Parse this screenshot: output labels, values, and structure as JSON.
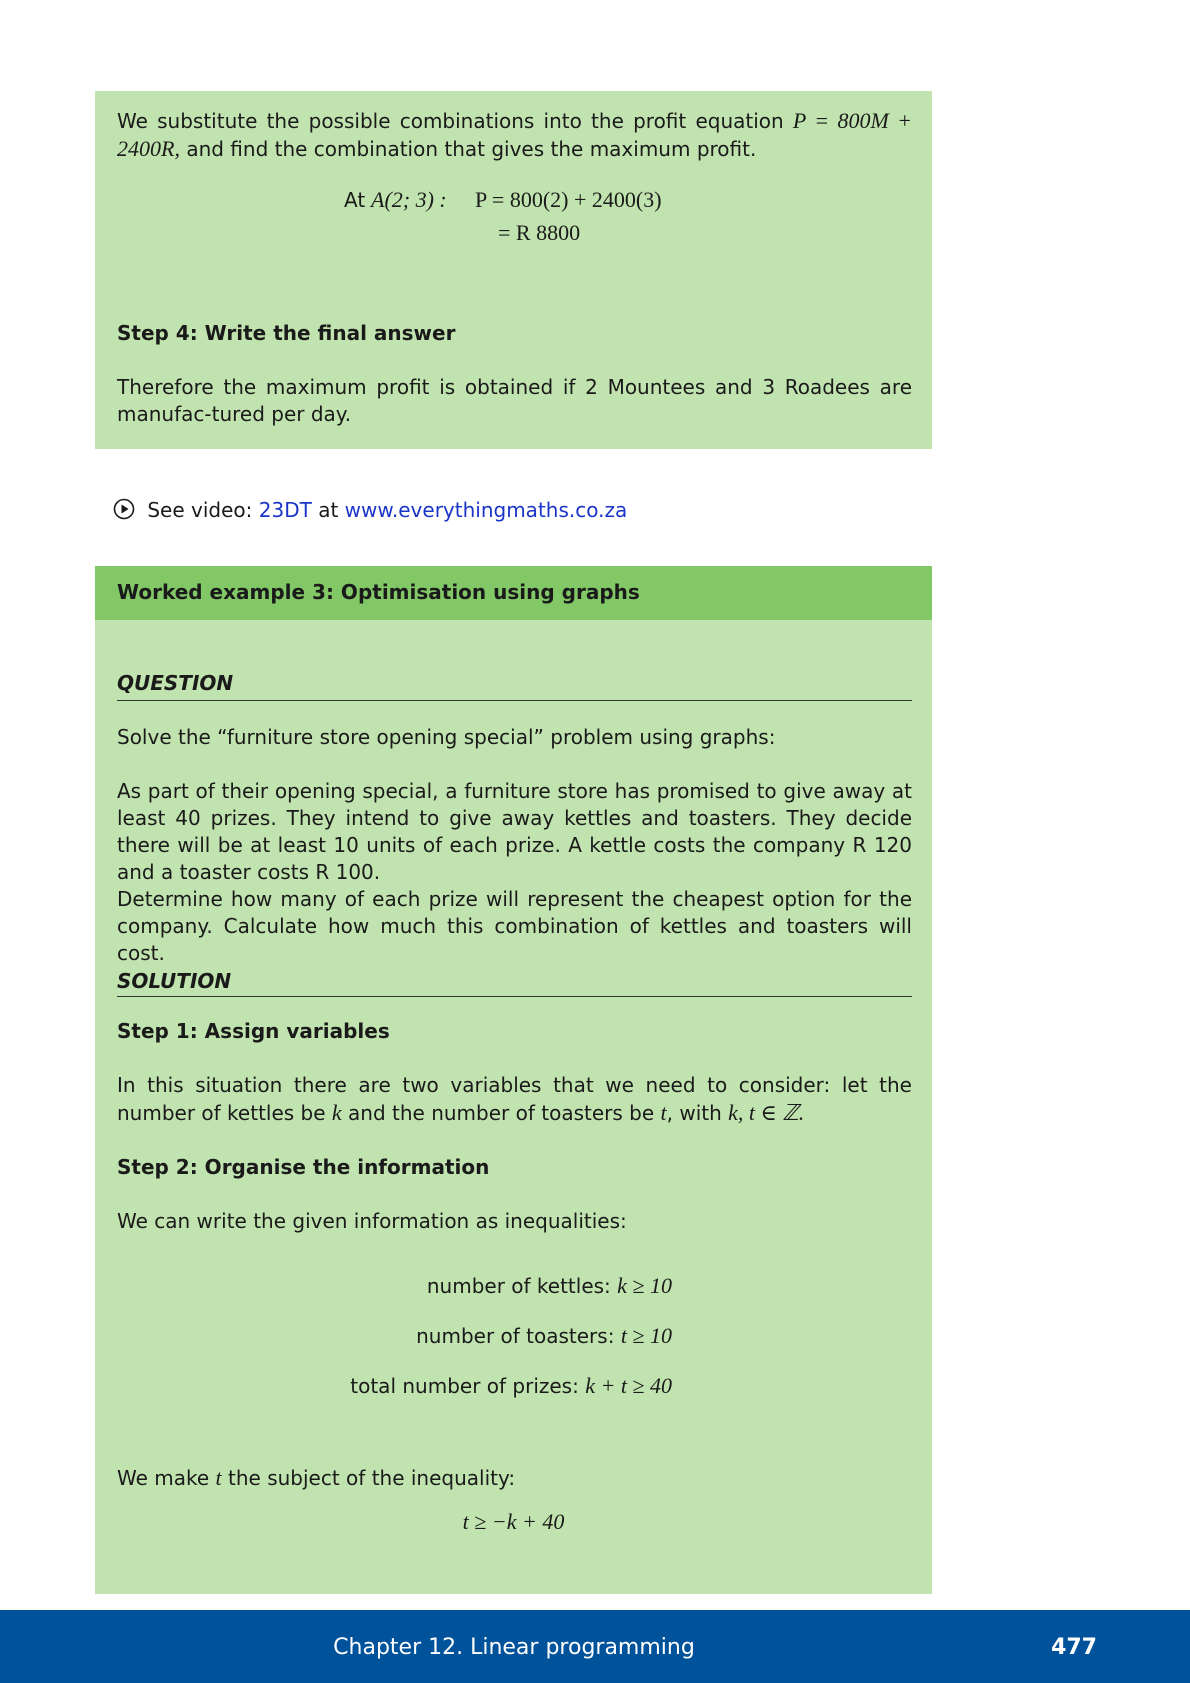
{
  "box1": {
    "intro_text": "We substitute the possible combinations into the profit equation",
    "intro_eq": "P = 800M + 2400R,",
    "intro_text2": "and find the combination that gives the maximum profit.",
    "at_label": "At",
    "at_point": "A(2; 3) :",
    "eq_line1": "P = 800(2) + 2400(3)",
    "eq_line2": "= R 8800",
    "step4_heading": "Step 4: Write the final answer",
    "step4_text": "Therefore the maximum profit is obtained if 2 Mountees and 3 Roadees are manufac-tured per day."
  },
  "video": {
    "prefix": "See video:",
    "code": "23DT",
    "mid": "at",
    "url": "www.everythingmaths.co.za"
  },
  "example": {
    "title": "Worked example 3:  Optimisation using graphs",
    "question_label": "QUESTION",
    "question_intro": "Solve the “furniture store opening special” problem using graphs:",
    "question_p1": "As part of their opening special, a furniture store has promised to give away at least 40 prizes. They intend to give away kettles and toasters. They decide there will be at least 10 units of each prize. A kettle costs the company R 120 and a toaster costs R 100.",
    "question_p2": "Determine how many of each prize will represent the cheapest option for the company. Calculate how much this combination of kettles and toasters will cost.",
    "solution_label": "SOLUTION",
    "step1_heading": "Step 1: Assign variables",
    "step1_text_a": "In this situation there are two variables that we need to consider: let the number of kettles be",
    "step1_k": "k",
    "step1_text_b": "and the number of toasters be",
    "step1_t": "t",
    "step1_text_c": ", with",
    "step1_set": "k, t ∈ ℤ.",
    "step2_heading": "Step 2: Organise the information",
    "step2_intro": "We can write the given information as inequalities:",
    "ineq1_label": "number of kettles:",
    "ineq1_math": "k ≥ 10",
    "ineq2_label": "number of toasters:",
    "ineq2_math": "t ≥ 10",
    "ineq3_label": "total number of prizes:",
    "ineq3_math": "k + t ≥ 40",
    "subject_text_a": "We make",
    "subject_t": "t",
    "subject_text_b": "the subject of the inequality:",
    "subject_eq": "t ≥ −k + 40"
  },
  "footer": {
    "chapter": "Chapter 12.   Linear programming",
    "page": "477"
  },
  "colors": {
    "box_bg": "#c1e3af",
    "header_bg": "#82c867",
    "footer_bg": "#00529b",
    "link": "#1a35c8"
  }
}
